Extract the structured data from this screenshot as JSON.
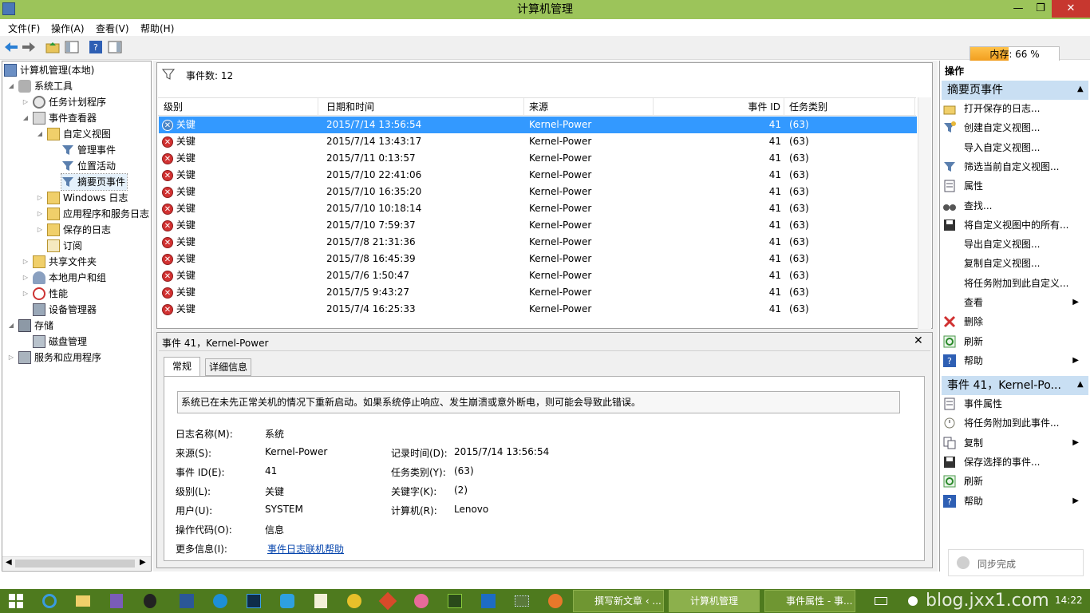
{
  "window": {
    "title": "计算机管理",
    "minimize": "—",
    "restore": "❐",
    "close": "✕"
  },
  "menu": [
    "文件(F)",
    "操作(A)",
    "查看(V)",
    "帮助(H)"
  ],
  "memory": {
    "label": "内存: 66 %",
    "percent": 66
  },
  "tree": {
    "root": "计算机管理(本地)",
    "system_tools": "系统工具",
    "task_scheduler": "任务计划程序",
    "event_viewer": "事件查看器",
    "custom_views": "自定义视图",
    "admin_events": "管理事件",
    "location_activity": "位置活动",
    "summary_events": "摘要页事件",
    "windows_logs": "Windows 日志",
    "app_service_logs": "应用程序和服务日志",
    "saved_logs": "保存的日志",
    "subscriptions": "订阅",
    "shared_folders": "共享文件夹",
    "local_users": "本地用户和组",
    "performance": "性能",
    "device_manager": "设备管理器",
    "storage": "存储",
    "disk_management": "磁盘管理",
    "services_apps": "服务和应用程序"
  },
  "events": {
    "count_label": "事件数: 12",
    "columns": [
      "级别",
      "日期和时间",
      "来源",
      "事件 ID",
      "任务类别"
    ],
    "rows": [
      {
        "level": "关键",
        "datetime": "2015/7/14 13:56:54",
        "source": "Kernel-Power",
        "id": "41",
        "category": "(63)"
      },
      {
        "level": "关键",
        "datetime": "2015/7/14 13:43:17",
        "source": "Kernel-Power",
        "id": "41",
        "category": "(63)"
      },
      {
        "level": "关键",
        "datetime": "2015/7/11 0:13:57",
        "source": "Kernel-Power",
        "id": "41",
        "category": "(63)"
      },
      {
        "level": "关键",
        "datetime": "2015/7/10 22:41:06",
        "source": "Kernel-Power",
        "id": "41",
        "category": "(63)"
      },
      {
        "level": "关键",
        "datetime": "2015/7/10 16:35:20",
        "source": "Kernel-Power",
        "id": "41",
        "category": "(63)"
      },
      {
        "level": "关键",
        "datetime": "2015/7/10 10:18:14",
        "source": "Kernel-Power",
        "id": "41",
        "category": "(63)"
      },
      {
        "level": "关键",
        "datetime": "2015/7/10 7:59:37",
        "source": "Kernel-Power",
        "id": "41",
        "category": "(63)"
      },
      {
        "level": "关键",
        "datetime": "2015/7/8 21:31:36",
        "source": "Kernel-Power",
        "id": "41",
        "category": "(63)"
      },
      {
        "level": "关键",
        "datetime": "2015/7/8 16:45:39",
        "source": "Kernel-Power",
        "id": "41",
        "category": "(63)"
      },
      {
        "level": "关键",
        "datetime": "2015/7/6 1:50:47",
        "source": "Kernel-Power",
        "id": "41",
        "category": "(63)"
      },
      {
        "level": "关键",
        "datetime": "2015/7/5 9:43:27",
        "source": "Kernel-Power",
        "id": "41",
        "category": "(63)"
      },
      {
        "level": "关键",
        "datetime": "2015/7/4 16:25:33",
        "source": "Kernel-Power",
        "id": "41",
        "category": "(63)"
      }
    ]
  },
  "detail": {
    "title": "事件 41，Kernel-Power",
    "tabs": [
      "常规",
      "详细信息"
    ],
    "message": "系统已在未先正常关机的情况下重新启动。如果系统停止响应、发生崩溃或意外断电，则可能会导致此错误。",
    "log_name_label": "日志名称(M):",
    "log_name": "系统",
    "source_label": "来源(S):",
    "source": "Kernel-Power",
    "logged_label": "记录时间(D):",
    "logged": "2015/7/14 13:56:54",
    "event_id_label": "事件 ID(E):",
    "event_id": "41",
    "task_cat_label": "任务类别(Y):",
    "task_cat": "(63)",
    "level_label": "级别(L):",
    "level": "关键",
    "keywords_label": "关键字(K):",
    "keywords": "(2)",
    "user_label": "用户(U):",
    "user": "SYSTEM",
    "computer_label": "计算机(R):",
    "computer": "Lenovo",
    "opcode_label": "操作代码(O):",
    "opcode": "信息",
    "more_info_label": "更多信息(I):",
    "more_info_link": "事件日志联机帮助"
  },
  "actions": {
    "header": "操作",
    "section1": "摘要页事件",
    "items1": [
      "打开保存的日志...",
      "创建自定义视图...",
      "导入自定义视图...",
      "筛选当前自定义视图...",
      "属性",
      "查找...",
      "将自定义视图中的所有...",
      "导出自定义视图...",
      "复制自定义视图...",
      "将任务附加到此自定义...",
      "查看",
      "删除",
      "刷新",
      "帮助"
    ],
    "section2": "事件 41，Kernel-Po...",
    "items2": [
      "事件属性",
      "将任务附加到此事件...",
      "复制",
      "保存选择的事件...",
      "刷新",
      "帮助"
    ]
  },
  "sync": "同步完成",
  "taskbar": {
    "windows": [
      "撰写新文章 ‹ ...",
      "计算机管理",
      "事件属性 - 事..."
    ],
    "tray": "blog.jxx1.com",
    "clock": "14:22"
  }
}
